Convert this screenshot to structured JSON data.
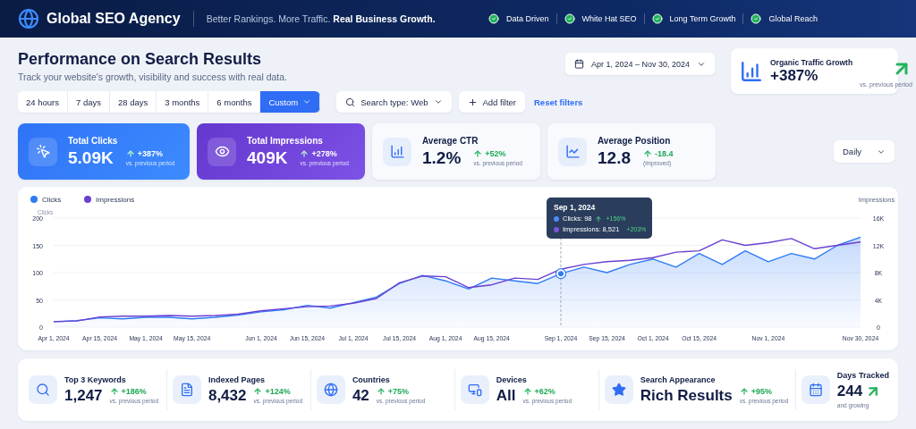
{
  "header": {
    "brand": "Global SEO Agency",
    "tagline": "Better Rankings. More Traffic. **Real Business Growth.**",
    "badges": [
      {
        "label": "Data Driven"
      },
      {
        "label": "White Hat SEO"
      },
      {
        "label": "Long Term Growth"
      },
      {
        "label": "Global Reach"
      }
    ]
  },
  "page": {
    "title": "Performance on Search Results",
    "subtitle": "Track your website's growth, visibility and success with real data."
  },
  "date_range": {
    "label": "Apr 1, 2024 – Nov 30, 2024"
  },
  "growth_card": {
    "title": "Organic Traffic Growth",
    "value": "+387%",
    "note": "vs. previous period"
  },
  "range_tabs": [
    {
      "label": "24 hours",
      "selected": false
    },
    {
      "label": "7 days",
      "selected": false
    },
    {
      "label": "28 days",
      "selected": false
    },
    {
      "label": "3 months",
      "selected": false
    },
    {
      "label": "6 months",
      "selected": false
    },
    {
      "label": "Custom",
      "selected": true
    }
  ],
  "search_type": {
    "label": "Search type: Web"
  },
  "add_filter": {
    "label": "Add filter"
  },
  "reset_filters": {
    "label": "Reset filters"
  },
  "kpis": [
    {
      "kind": "clicks",
      "title": "Total Clicks",
      "value": "5.09K",
      "change": "+387%",
      "note": "vs. previous period"
    },
    {
      "kind": "impressions",
      "title": "Total Impressions",
      "value": "409K",
      "change": "+278%",
      "note": "vs. previous period"
    },
    {
      "kind": "ctr",
      "title": "Average CTR",
      "value": "1.2%",
      "change": "+52%",
      "note": "vs. previous period"
    },
    {
      "kind": "position",
      "title": "Average Position",
      "value": "12.8",
      "change": "-18.4",
      "note": "(improved)"
    }
  ],
  "interval": {
    "label": "Daily"
  },
  "chart": {
    "chart_data": {
      "type": "line",
      "ylabel": "Clicks",
      "y2label": "Impressions",
      "categories": [
        "Apr 1, 2024",
        null,
        "Apr 15, 2024",
        null,
        "May 1, 2024",
        null,
        "May 15, 2024",
        null,
        null,
        "Jun 1, 2024",
        null,
        "Jun 15, 2024",
        null,
        "Jul 1, 2024",
        null,
        "Jul 15, 2024",
        null,
        "Aug 1, 2024",
        null,
        "Aug 15, 2024",
        null,
        null,
        "Sep 1, 2024",
        null,
        "Sep 15, 2024",
        null,
        "Oct 1, 2024",
        null,
        "Oct 15, 2024",
        null,
        null,
        "Nov 1, 2024",
        null,
        null,
        null,
        "Nov 30, 2024"
      ],
      "series": [
        {
          "name": "Clicks",
          "color": "#2f7bf5",
          "type": "area",
          "values": [
            10,
            12,
            17,
            15,
            18,
            18,
            15,
            18,
            22,
            28,
            32,
            40,
            35,
            45,
            55,
            80,
            95,
            85,
            70,
            90,
            85,
            80,
            98,
            110,
            100,
            115,
            125,
            110,
            135,
            115,
            140,
            120,
            135,
            125,
            150,
            165
          ]
        },
        {
          "name": "Impressions",
          "color": "#6a3fd1",
          "axis": "y2",
          "values": [
            800,
            900,
            1500,
            1600,
            1600,
            1700,
            1600,
            1700,
            1900,
            2400,
            2700,
            3000,
            3100,
            3500,
            4200,
            6500,
            7500,
            7400,
            5800,
            6200,
            7200,
            7000,
            8500,
            9200,
            9600,
            9800,
            10200,
            11000,
            11200,
            12800,
            12000,
            12400,
            13000,
            11500,
            12000,
            12500
          ]
        }
      ],
      "ylim": [
        0,
        200
      ],
      "y2lim": [
        0,
        16000
      ],
      "yticks": [
        0,
        50,
        100,
        150,
        200
      ],
      "y2ticks": [
        {
          "value": 0,
          "label": "0"
        },
        {
          "value": 4000,
          "label": "4K"
        },
        {
          "value": 8000,
          "label": "8K"
        },
        {
          "value": 12000,
          "label": "12K"
        },
        {
          "value": 16000,
          "label": "16K"
        }
      ],
      "annotations": [
        "Sep 1, 2024"
      ],
      "grid": true,
      "legend": true
    },
    "tooltip": {
      "items": [
        {
          "label": "Clicks: 98",
          "change": "+156%"
        },
        {
          "label": "Impressions: 8,521",
          "change": "+203%"
        }
      ]
    }
  },
  "stats": [
    {
      "kind": "keywords",
      "title": "Top 3 Keywords",
      "value": "1,247",
      "change": "+186%",
      "note": "vs. previous period"
    },
    {
      "kind": "pages",
      "title": "Indexed Pages",
      "value": "8,432",
      "change": "+124%",
      "note": "vs. previous period"
    },
    {
      "kind": "countries",
      "title": "Countries",
      "value": "42",
      "change": "+75%",
      "note": "vs. previous period"
    },
    {
      "kind": "devices",
      "title": "Devices",
      "value": "All",
      "change": "+62%",
      "note": "vs. previous period"
    },
    {
      "kind": "appearance",
      "title": "Search Appearance",
      "value": "Rich Results",
      "change": "+95%",
      "note": "vs. previous period"
    },
    {
      "kind": "days",
      "title": "Days Tracked",
      "value": "244",
      "note": "and growing"
    }
  ]
}
